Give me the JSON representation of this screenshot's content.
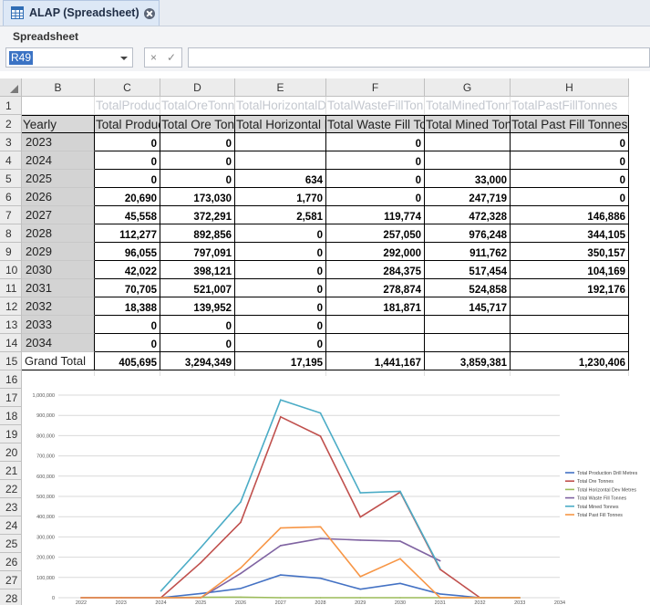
{
  "tab": {
    "title": "ALAP (Spreadsheet)",
    "icon": "spreadsheet-icon"
  },
  "panel": {
    "title": "Spreadsheet"
  },
  "formula_bar": {
    "name_box": "R49",
    "cancel_glyph": "×",
    "confirm_glyph": "✓",
    "formula": ""
  },
  "columns": [
    "B",
    "C",
    "D",
    "E",
    "F",
    "G",
    "H"
  ],
  "rows": [
    "1",
    "2",
    "3",
    "4",
    "5",
    "6",
    "7",
    "8",
    "9",
    "10",
    "11",
    "12",
    "13",
    "14",
    "15",
    "16",
    "17",
    "18",
    "19",
    "20",
    "21",
    "22",
    "23",
    "24",
    "25",
    "26",
    "27",
    "28"
  ],
  "sheet": {
    "row1": [
      "",
      "TotalProductionDrillMetres",
      "TotalOreTonnes",
      "TotalHorizontalDevMetres",
      "TotalWasteFillTonnes",
      "TotalMinedTonnes",
      "TotalPastFillTonnes"
    ],
    "row2": [
      "Yearly",
      "Total Production Drill Metres",
      "Total Ore Tonnes",
      "Total Horizontal Dev Metres",
      "Total Waste Fill Tonnes",
      "Total Mined Tonnes",
      "Total Past Fill Tonnes"
    ],
    "years": [
      "2023",
      "2024",
      "2025",
      "2026",
      "2027",
      "2028",
      "2029",
      "2030",
      "2031",
      "2032",
      "2033",
      "2034"
    ],
    "data": [
      [
        "0",
        "0",
        "",
        "0",
        "",
        "0"
      ],
      [
        "0",
        "0",
        "",
        "0",
        "",
        "0"
      ],
      [
        "0",
        "0",
        "634",
        "0",
        "33,000",
        "0"
      ],
      [
        "20,690",
        "173,030",
        "1,770",
        "0",
        "247,719",
        "0"
      ],
      [
        "45,558",
        "372,291",
        "2,581",
        "119,774",
        "472,328",
        "146,886"
      ],
      [
        "112,277",
        "892,856",
        "0",
        "257,050",
        "976,248",
        "344,105"
      ],
      [
        "96,055",
        "797,091",
        "0",
        "292,000",
        "911,762",
        "350,157"
      ],
      [
        "42,022",
        "398,121",
        "0",
        "284,375",
        "517,454",
        "104,169"
      ],
      [
        "70,705",
        "521,007",
        "0",
        "278,874",
        "524,858",
        "192,176"
      ],
      [
        "18,388",
        "139,952",
        "0",
        "181,871",
        "145,717",
        ""
      ],
      [
        "0",
        "0",
        "0",
        "",
        "",
        ""
      ],
      [
        "0",
        "0",
        "0",
        "",
        "",
        ""
      ]
    ],
    "grand_total_label": "Grand Total",
    "grand_total": [
      "405,695",
      "3,294,349",
      "17,195",
      "1,441,167",
      "3,859,381",
      "1,230,406"
    ]
  },
  "chart_data": {
    "type": "line",
    "x": [
      "2022",
      "2023",
      "2024",
      "2025",
      "2026",
      "2027",
      "2028",
      "2029",
      "2030",
      "2031",
      "2032",
      "2033",
      "2034"
    ],
    "ylim": [
      0,
      1000000
    ],
    "yticks": [
      "0",
      "100,000",
      "200,000",
      "300,000",
      "400,000",
      "500,000",
      "600,000",
      "700,000",
      "800,000",
      "900,000",
      "1,000,000"
    ],
    "grid": true,
    "legend_position": "right",
    "series": [
      {
        "name": "Total Production Drill Metres",
        "color": "#4472c4",
        "values": [
          0,
          0,
          0,
          20690,
          45558,
          112277,
          96055,
          42022,
          70705,
          18388,
          0,
          0,
          null
        ]
      },
      {
        "name": "Total Ore Tonnes",
        "color": "#c0504d",
        "values": [
          0,
          0,
          0,
          173030,
          372291,
          892856,
          797091,
          398121,
          521007,
          139952,
          0,
          0,
          null
        ]
      },
      {
        "name": "Total Horizontal Dev Metres",
        "color": "#9bbb59",
        "values": [
          null,
          null,
          634,
          1770,
          2581,
          0,
          0,
          0,
          0,
          0,
          0,
          0,
          null
        ]
      },
      {
        "name": "Total Waste Fill Tonnes",
        "color": "#8064a2",
        "values": [
          0,
          0,
          0,
          0,
          119774,
          257050,
          292000,
          284375,
          278874,
          181871,
          null,
          null,
          null
        ]
      },
      {
        "name": "Total Mined Tonnes",
        "color": "#4bacc6",
        "values": [
          null,
          null,
          33000,
          247719,
          472328,
          976248,
          911762,
          517454,
          524858,
          145717,
          null,
          null,
          null
        ]
      },
      {
        "name": "Total Past Fill Tonnes",
        "color": "#f79646",
        "values": [
          0,
          0,
          0,
          0,
          146886,
          344105,
          350157,
          104169,
          192176,
          0,
          0,
          0,
          null
        ]
      }
    ]
  }
}
